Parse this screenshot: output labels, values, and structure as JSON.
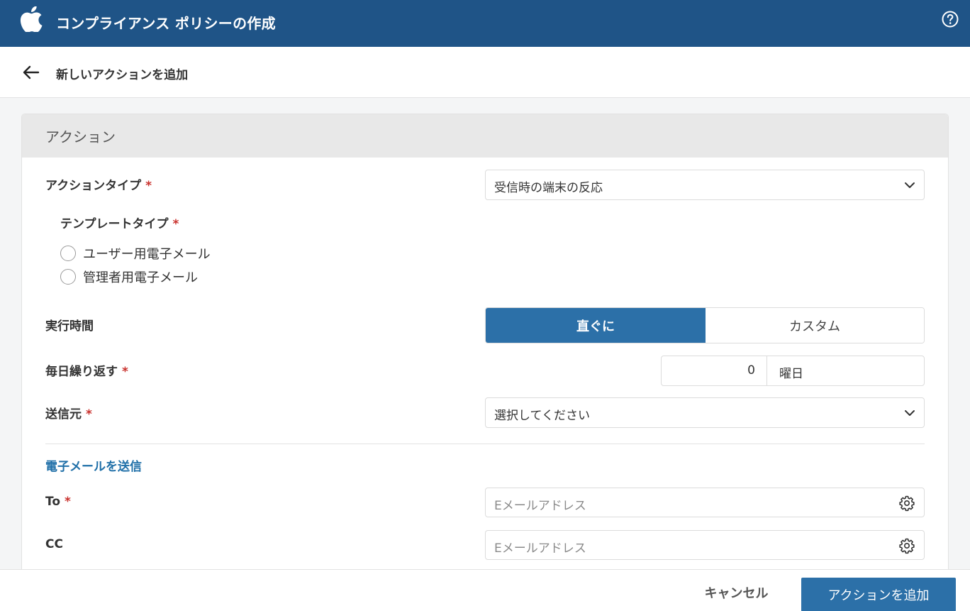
{
  "header": {
    "title": "コンプライアンス ポリシーの作成",
    "logo_icon": "apple-logo-icon",
    "help_icon": "help-icon"
  },
  "subheader": {
    "title": "新しいアクションを追加",
    "back_icon": "back-arrow-icon"
  },
  "card": {
    "title": "アクション"
  },
  "form": {
    "action_type": {
      "label": "アクションタイプ",
      "required": "*",
      "value": "受信時の端末の反応"
    },
    "template_type": {
      "label": "テンプレートタイプ",
      "required": "*",
      "options": [
        "ユーザー用電子メール",
        "管理者用電子メール"
      ]
    },
    "exec_time": {
      "label": "実行時間",
      "options": [
        "直ぐに",
        "カスタム"
      ],
      "selected": "直ぐに"
    },
    "repeat_daily": {
      "label": "毎日繰り返す",
      "required": "*",
      "value": "0",
      "unit": "曜日"
    },
    "sender": {
      "label": "送信元",
      "required": "*",
      "value": "選択してください"
    },
    "email_section": {
      "title": "電子メールを送信"
    },
    "to": {
      "label": "To",
      "required": "*",
      "placeholder": "Eメールアドレス"
    },
    "cc": {
      "label": "CC",
      "placeholder": "Eメールアドレス"
    }
  },
  "footer": {
    "cancel_label": "キャンセル",
    "add_label": "アクションを追加"
  },
  "colors": {
    "header_bg": "#1f5487",
    "accent": "#2c70a8",
    "required": "#c9302c",
    "section_title": "#1f6fa8"
  }
}
